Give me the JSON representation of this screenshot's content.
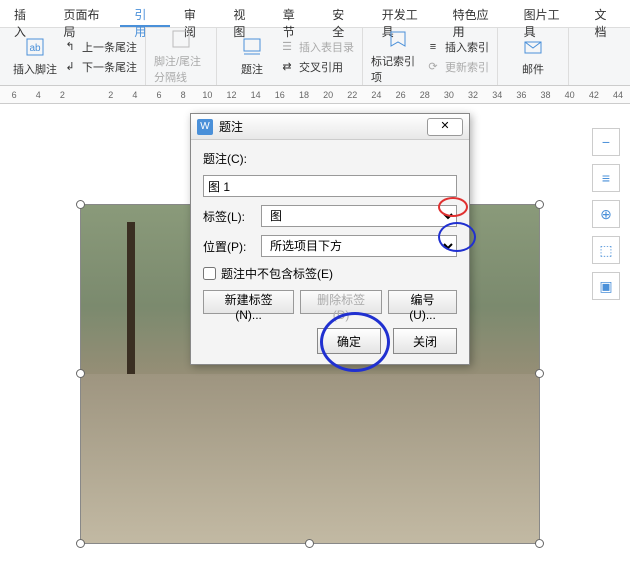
{
  "tabs": [
    "插入",
    "页面布局",
    "引用",
    "审阅",
    "视图",
    "章节",
    "安全",
    "开发工具",
    "特色应用",
    "图片工具",
    "文档"
  ],
  "active_tab": 2,
  "ribbon": {
    "insert_footnote": "插入脚注",
    "prev_endnote": "上一条尾注",
    "next_endnote": "下一条尾注",
    "footnote_separator": "脚注/尾注分隔线",
    "caption": "题注",
    "insert_toc": "插入表目录",
    "cross_ref": "交叉引用",
    "mark_index": "标记索引项",
    "insert_index": "插入索引",
    "update_index": "更新索引",
    "mail": "邮件"
  },
  "ruler": [
    6,
    4,
    2,
    "",
    2,
    4,
    6,
    8,
    10,
    12,
    14,
    16,
    18,
    20,
    22,
    24,
    26,
    28,
    30,
    32,
    34,
    36,
    38,
    40,
    42,
    44
  ],
  "sidetools": [
    "−",
    "≡",
    "⊕",
    "⬚",
    "▣"
  ],
  "dialog": {
    "title": "题注",
    "label_caption": "题注(C):",
    "caption_value": "图 1",
    "label_tag": "标签(L):",
    "tag_value": "图",
    "label_pos": "位置(P):",
    "pos_value": "所选项目下方",
    "exclude_label": "题注中不包含标签(E)",
    "btn_new": "新建标签(N)...",
    "btn_del": "删除标签(D)",
    "btn_num": "编号(U)...",
    "btn_ok": "确定",
    "btn_close": "关闭"
  }
}
